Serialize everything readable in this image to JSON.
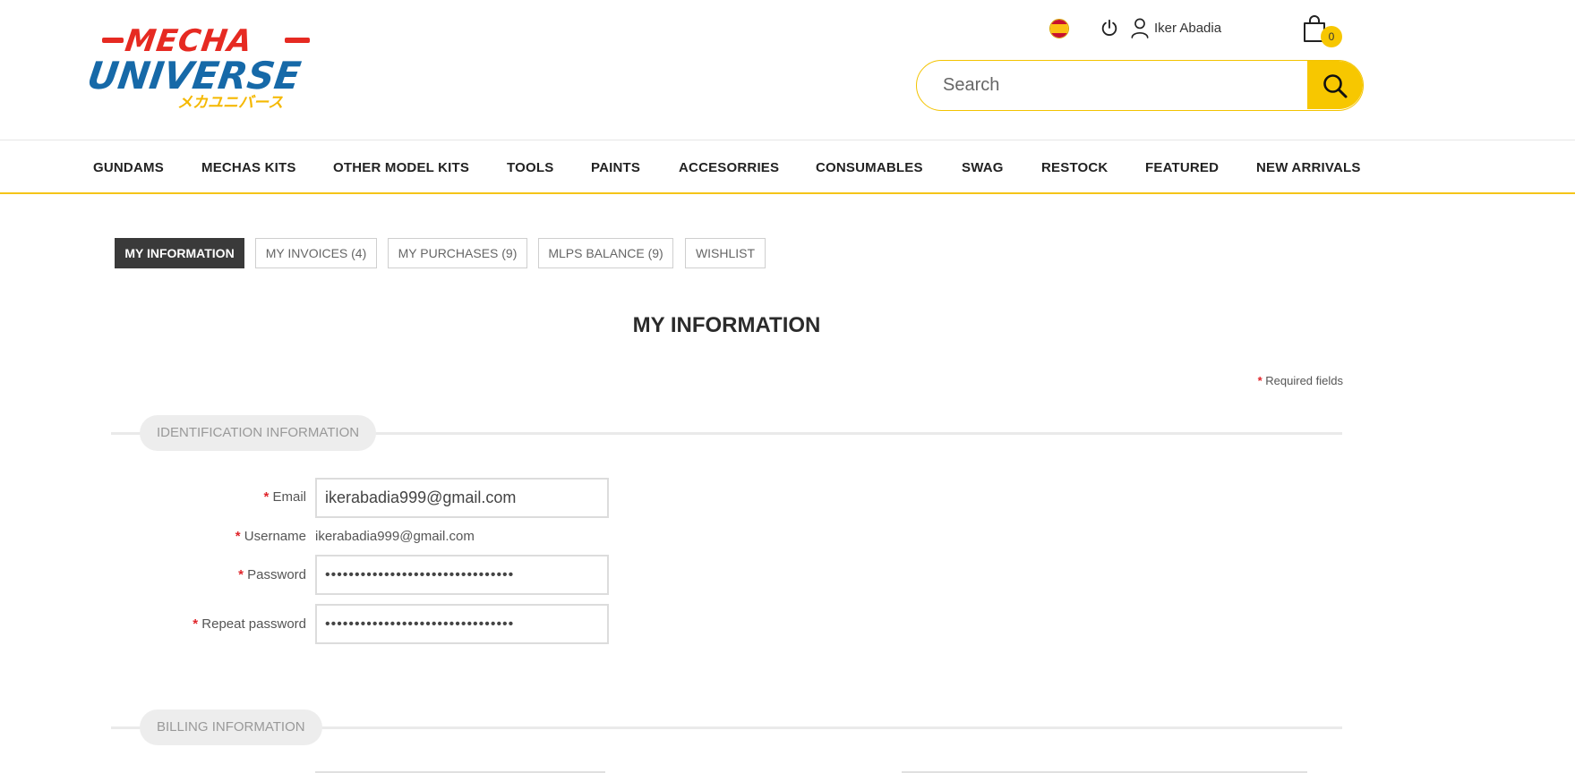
{
  "header": {
    "logo": {
      "top_word": "MECHA",
      "main_word": "UNIVERSE",
      "japanese": "メカユニバース"
    },
    "language_flag": "spain-flag-icon",
    "user_name": "Iker Abadia",
    "cart_count": "0",
    "search": {
      "placeholder": "Search"
    },
    "colors": {
      "accent_yellow": "#F7C700",
      "logo_red": "#E62A22",
      "logo_blue": "#1669A8"
    }
  },
  "nav": {
    "items": [
      "GUNDAMS",
      "MECHAS KITS",
      "OTHER MODEL KITS",
      "TOOLS",
      "PAINTS",
      "ACCESORRIES",
      "CONSUMABLES",
      "SWAG",
      "RESTOCK",
      "FEATURED",
      "NEW ARRIVALS"
    ]
  },
  "tabs": [
    {
      "label": "MY INFORMATION",
      "active": true
    },
    {
      "label": "MY INVOICES (4)",
      "active": false
    },
    {
      "label": "MY PURCHASES (9)",
      "active": false
    },
    {
      "label": "MLPS BALANCE (9)",
      "active": false
    },
    {
      "label": "WISHLIST",
      "active": false
    }
  ],
  "main": {
    "title": "MY INFORMATION",
    "required_star": "*",
    "required_note": "Required fields",
    "sections": {
      "identification": "IDENTIFICATION INFORMATION",
      "billing": "BILLING INFORMATION"
    },
    "form": {
      "email_label": "Email",
      "email_value": "ikerabadia999@gmail.com",
      "username_label": "Username",
      "username_value": "ikerabadia999@gmail.com",
      "password_label": "Password",
      "password_value": "••••••••••••••••••••••••••••••••",
      "repeat_password_label": "Repeat password",
      "repeat_password_value": "••••••••••••••••••••••••••••••••"
    }
  }
}
